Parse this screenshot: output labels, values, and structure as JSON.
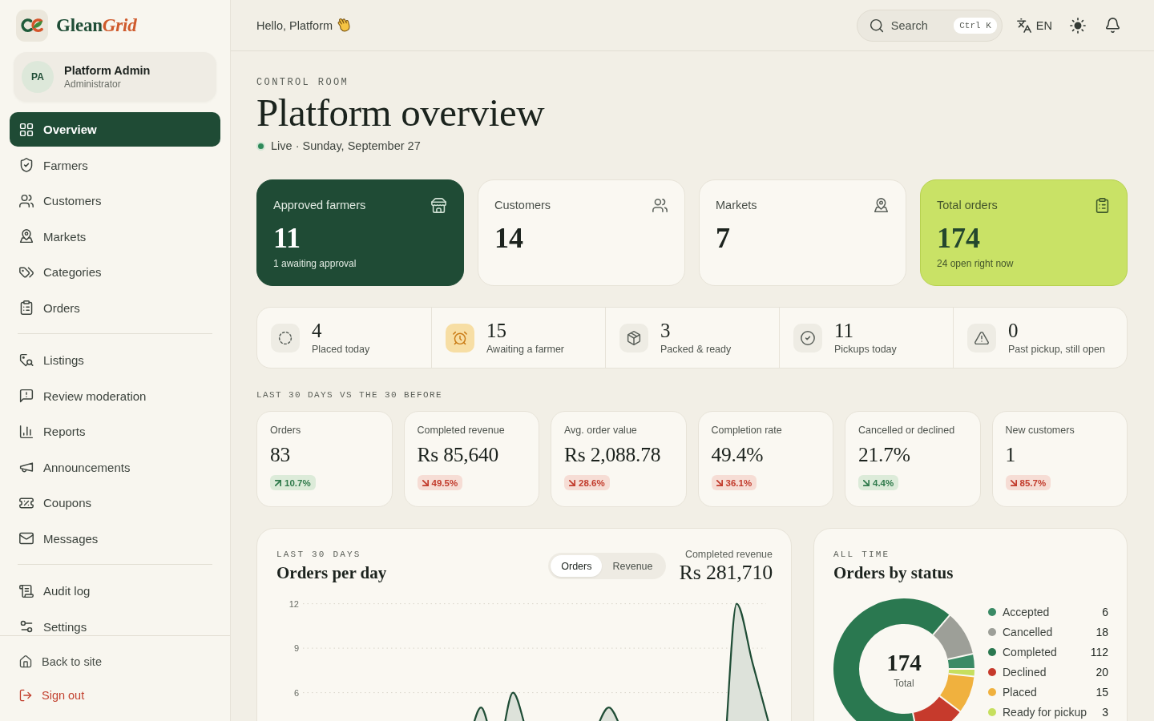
{
  "sidebar": {
    "brand": {
      "parts": [
        {
          "text": "Glean",
          "kind": "plain"
        },
        {
          "text": "Grid",
          "kind": "accent"
        }
      ]
    },
    "user": {
      "initials": "PA",
      "name": "Platform Admin",
      "role": "Administrator"
    },
    "groups": [
      {
        "items": [
          {
            "label": "Overview",
            "selected": true
          },
          {
            "label": "Farmers",
            "selected": false
          },
          {
            "label": "Customers",
            "selected": false
          },
          {
            "label": "Markets",
            "selected": false
          },
          {
            "label": "Categories",
            "selected": false
          },
          {
            "label": "Orders",
            "selected": false
          }
        ]
      },
      {
        "items": [
          {
            "label": "Listings",
            "selected": false
          },
          {
            "label": "Review moderation",
            "selected": false
          },
          {
            "label": "Reports",
            "selected": false
          },
          {
            "label": "Announcements",
            "selected": false
          },
          {
            "label": "Coupons",
            "selected": false
          },
          {
            "label": "Messages",
            "selected": false
          }
        ]
      },
      {
        "items": [
          {
            "label": "Audit log",
            "selected": false
          },
          {
            "label": "Settings",
            "selected": false
          }
        ]
      }
    ],
    "footer": [
      {
        "label": "Back to site",
        "kind": "link"
      },
      {
        "label": "Sign out",
        "kind": "danger"
      }
    ]
  },
  "topbar": {
    "greeting": "Hello, Platform",
    "search": {
      "placeholder": "Search",
      "shortcut": "Ctrl K"
    },
    "language": "EN"
  },
  "page": {
    "eyebrow": "CONTROL ROOM",
    "title": "Platform overview",
    "status": "Live · Sunday, September 27"
  },
  "kpis": [
    {
      "label": "Approved farmers",
      "value": "11",
      "note": "1 awaiting approval",
      "kind": "dark"
    },
    {
      "label": "Customers",
      "value": "14",
      "kind": "plain"
    },
    {
      "label": "Markets",
      "value": "7",
      "kind": "plain"
    },
    {
      "label": "Total orders",
      "value": "174",
      "note": "24 open right now",
      "kind": "lime"
    }
  ],
  "pipeline": [
    {
      "value": "4",
      "label": "Placed today",
      "kind": "default"
    },
    {
      "value": "15",
      "label": "Awaiting a farmer",
      "kind": "warning"
    },
    {
      "value": "3",
      "label": "Packed & ready",
      "kind": "default"
    },
    {
      "value": "11",
      "label": "Pickups today",
      "kind": "default"
    },
    {
      "value": "0",
      "label": "Past pickup, still open",
      "kind": "default"
    }
  ],
  "comparison": {
    "heading": "LAST 30 DAYS VS THE 30 BEFORE",
    "metrics": [
      {
        "label": "Orders",
        "value": "83",
        "change": "10.7%",
        "kind": "up",
        "good": true
      },
      {
        "label": "Completed revenue",
        "value": "Rs 85,640",
        "change": "49.5%",
        "kind": "down",
        "good": false
      },
      {
        "label": "Avg. order value",
        "value": "Rs 2,088.78",
        "change": "28.6%",
        "kind": "down",
        "good": false
      },
      {
        "label": "Completion rate",
        "value": "49.4%",
        "change": "36.1%",
        "kind": "down",
        "good": false
      },
      {
        "label": "Cancelled or declined",
        "value": "21.7%",
        "change": "4.4%",
        "kind": "down",
        "good": true
      },
      {
        "label": "New customers",
        "value": "1",
        "change": "85.7%",
        "kind": "down",
        "good": false
      }
    ]
  },
  "orders_chart": {
    "eyebrow": "LAST 30 DAYS",
    "title": "Orders per day",
    "toggle": [
      {
        "label": "Orders",
        "selected": true
      },
      {
        "label": "Revenue",
        "selected": false
      }
    ],
    "summary_label": "Completed revenue",
    "summary_value": "Rs 281,710",
    "chart_data": {
      "type": "area",
      "categories": [
        null,
        null,
        null,
        null,
        null,
        null,
        null,
        null,
        null,
        null,
        null,
        null,
        null,
        null,
        null,
        null,
        null,
        null,
        null,
        null,
        null,
        null,
        null,
        null,
        null,
        null,
        null,
        null,
        null,
        null
      ],
      "ylim": [
        0,
        12
      ],
      "yticks": [
        {
          "value": 6,
          "label": "6"
        },
        {
          "value": 9,
          "label": "9"
        },
        {
          "value": 12,
          "label": "12"
        }
      ],
      "series": [
        {
          "color": "#1f4d36",
          "values": [
            1,
            2,
            1,
            2,
            4,
            2,
            1,
            2,
            2,
            1,
            2,
            5,
            2,
            6,
            3,
            2,
            2,
            1,
            3,
            5,
            3,
            1,
            2,
            2,
            1,
            1,
            0,
            12,
            8,
            4
          ]
        }
      ]
    }
  },
  "status_chart": {
    "eyebrow": "ALL TIME",
    "title": "Orders by status",
    "center_value": "174",
    "center_label": "Total",
    "legend_counts": [
      "6",
      "18",
      "112",
      "20",
      "15",
      "3"
    ],
    "chart_data": {
      "type": "donut",
      "categories": [
        "Accepted",
        "Cancelled",
        "Completed",
        "Declined",
        "Placed",
        "Ready for pickup"
      ],
      "values": [
        3.45,
        10.34,
        64.38,
        11.49,
        8.62,
        1.72
      ],
      "colors": [
        "#3a8a65",
        "#9d9f98",
        "#2a7850",
        "#c63a2c",
        "#f0b13e",
        "#c6df5e"
      ]
    }
  }
}
